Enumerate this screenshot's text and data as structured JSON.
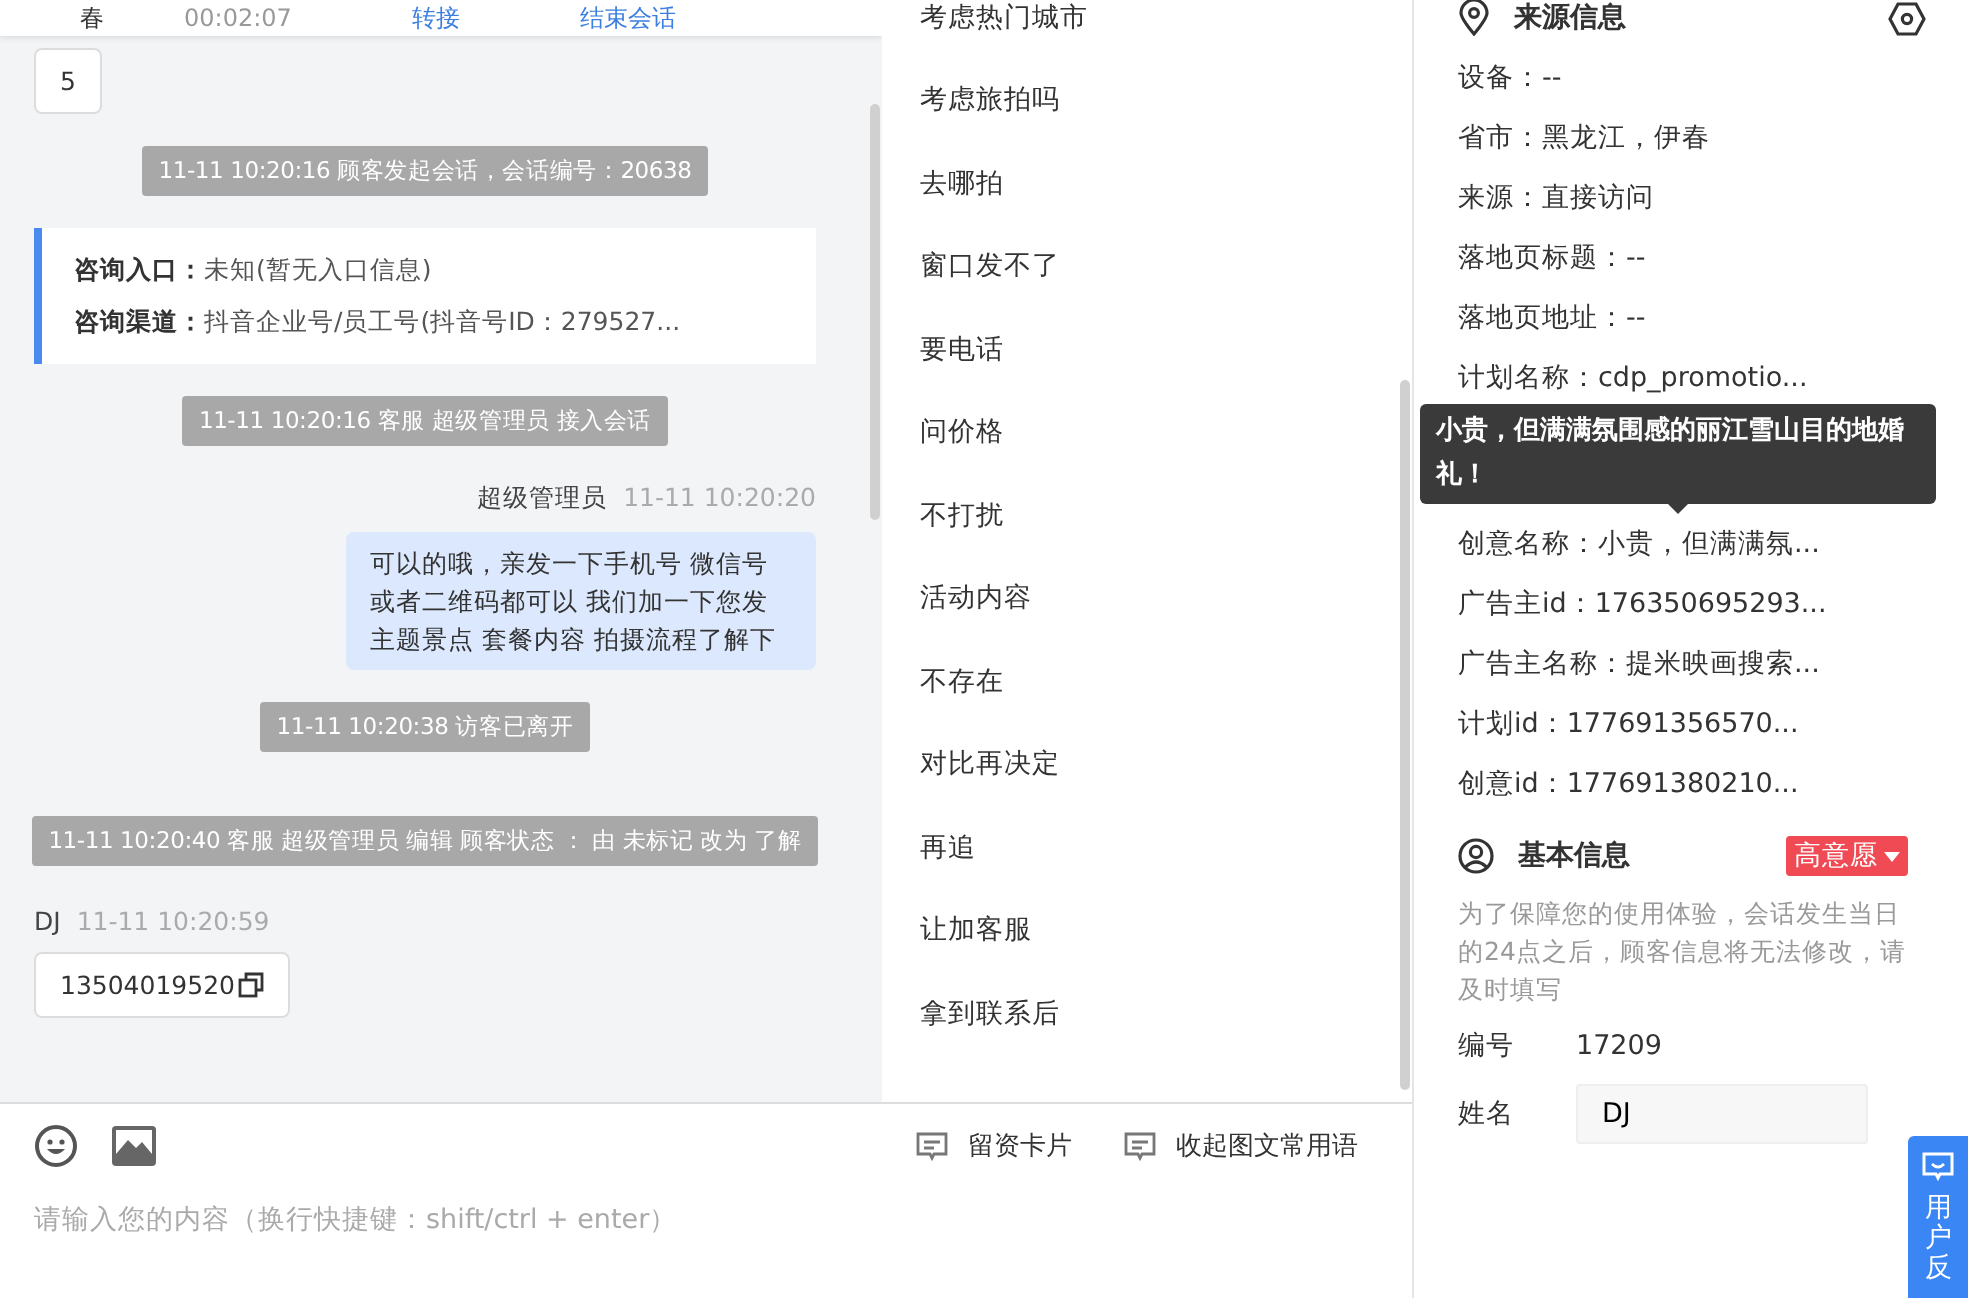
{
  "header": {
    "cells": [
      "春",
      "00:02:07"
    ],
    "actions": [
      "转接",
      "结束会话"
    ]
  },
  "chat": {
    "messages": [
      {
        "kind": "in",
        "text": "5"
      },
      {
        "kind": "system",
        "text": "11-11 10:20:16 顾客发起会话，会话编号：20638"
      },
      {
        "kind": "card",
        "fields": [
          {
            "label": "咨询入口：",
            "value": "未知(暂无入口信息)"
          },
          {
            "label": "咨询渠道：",
            "value": "抖音企业号/员工号(抖音号ID：279527..."
          }
        ]
      },
      {
        "kind": "system",
        "text": "11-11 10:20:16 客服 超级管理员 接入会话"
      },
      {
        "kind": "out",
        "sender": "超级管理员",
        "time": "11-11 10:20:20",
        "text": "可以的哦，亲发一下手机号 微信号或者二维码都可以 我们加一下您发主题景点 套餐内容 拍摄流程了解下"
      },
      {
        "kind": "system",
        "text": "11-11 10:20:38 访客已离开"
      },
      {
        "kind": "system",
        "text": "11-11 10:20:40 客服 超级管理员 编辑 顾客状态 ： 由 未标记 改为 了解"
      },
      {
        "kind": "in",
        "sender": "DJ",
        "time": "11-11 10:20:59",
        "text": "13504019520",
        "copyable": true
      }
    ]
  },
  "phrases": {
    "items": [
      "考虑热门城市",
      "考虑旅拍吗",
      "去哪拍",
      "窗口发不了",
      "要电话",
      "问价格",
      "不打扰",
      "活动内容",
      "不存在",
      "对比再决定",
      "再追",
      "让加客服",
      "拿到联系后"
    ]
  },
  "composer": {
    "placeholder": "请输入您的内容（换行快捷键：shift/ctrl + enter）",
    "actions": [
      "留资卡片",
      "收起图文常用语"
    ]
  },
  "source": {
    "title": "来源信息",
    "rows": [
      "设备：--",
      "省市：黑龙江，伊春",
      "来源：直接访问",
      "落地页标题：--",
      "落地页地址：--",
      "计划名称：cdp_promotio...",
      "创意名称：小贵，但满满氛...",
      "广告主id：176350695293...",
      "广告主名称：提米映画搜索...",
      "计划id：177691356570...",
      "创意id：177691380210..."
    ],
    "tooltip": "小贵，但满满氛围感的丽江雪山目的地婚礼！"
  },
  "basic": {
    "title": "基本信息",
    "intent": "高意愿",
    "notice": "为了保障您的使用体验，会话发生当日的24点之后，顾客信息将无法修改，请及时填写",
    "fields": [
      {
        "kind": "text",
        "label": "编号",
        "value": "17209"
      },
      {
        "kind": "input",
        "label": "姓名",
        "value": "DJ"
      }
    ]
  },
  "feedback": {
    "label": "用户反"
  }
}
